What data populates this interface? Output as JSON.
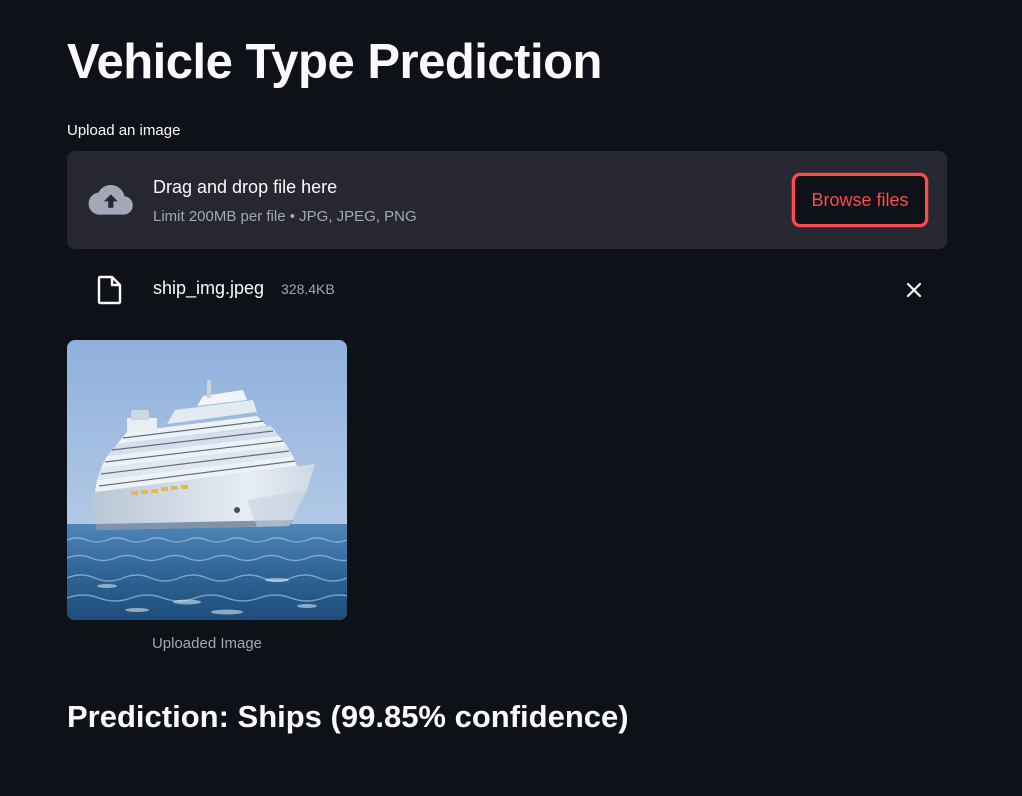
{
  "page": {
    "title": "Vehicle Type Prediction"
  },
  "uploader": {
    "label": "Upload an image",
    "dropzone_text": "Drag and drop file here",
    "limits_text": "Limit 200MB per file • JPG, JPEG, PNG",
    "browse_label": "Browse files",
    "icon": "cloud-upload-icon"
  },
  "uploaded_file": {
    "name": "ship_img.jpeg",
    "size": "328.4KB",
    "icon": "file-icon",
    "remove_icon": "close-icon"
  },
  "image": {
    "caption": "Uploaded Image"
  },
  "result": {
    "text": "Prediction: Ships (99.85% confidence)"
  },
  "colors": {
    "background": "#0e1117",
    "surface": "#262730",
    "accent": "#ff4b4b",
    "text": "#fafafa",
    "muted_text": "#a3a8b8"
  }
}
